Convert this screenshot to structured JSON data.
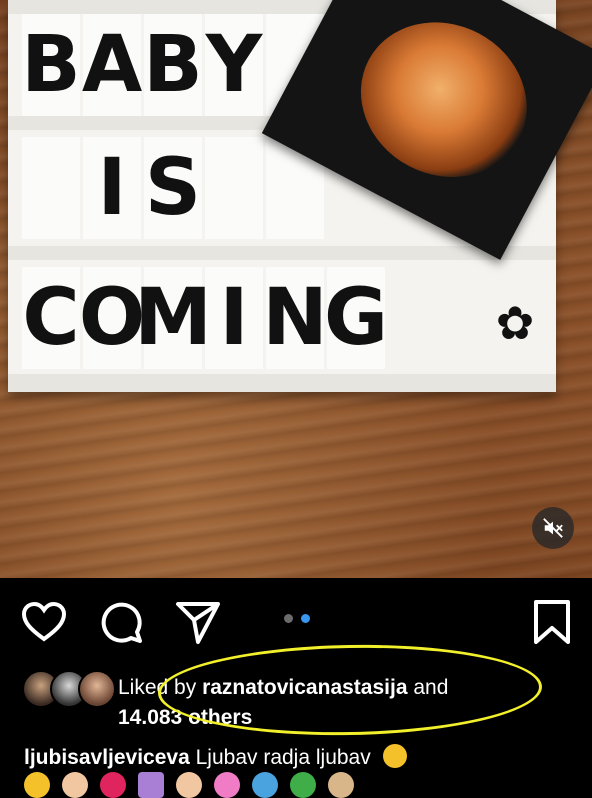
{
  "lightbox": {
    "rows": [
      [
        "B",
        "A",
        "B",
        "Y",
        "",
        "",
        "",
        ""
      ],
      [
        "",
        "I",
        "S",
        "",
        "",
        "",
        "",
        ""
      ],
      [
        "C",
        "O",
        "M",
        "I",
        "N",
        "G",
        "",
        ""
      ]
    ],
    "flower_icon": "flower-icon"
  },
  "media": {
    "mute_icon": "speaker-muted-icon"
  },
  "actions": {
    "like_icon": "heart-icon",
    "comment_icon": "comment-icon",
    "share_icon": "send-icon",
    "save_icon": "bookmark-icon"
  },
  "carousel": {
    "active_color": "#3897f0",
    "inactive_color": "#6b6b6b",
    "active_index": 1,
    "count": 2
  },
  "likes": {
    "prefix": "Liked by ",
    "user": "raznatovicanastasija",
    "suffix": " and",
    "others": "14.083 others"
  },
  "caption": {
    "user": "ljubisavljeviceva",
    "text": " Ljubav radja ljubav",
    "emoji_icon": "pleading-face-emoji"
  },
  "highlight_color": "#f2f02a"
}
